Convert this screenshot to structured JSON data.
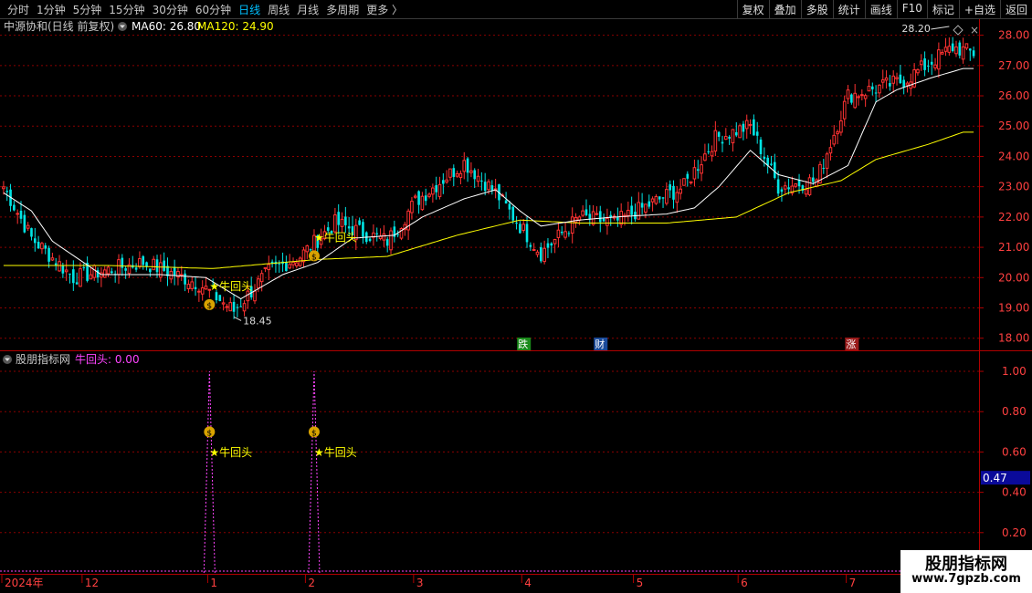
{
  "toolbar": {
    "periods": [
      "分时",
      "1分钟",
      "5分钟",
      "15分钟",
      "30分钟",
      "60分钟",
      "日线",
      "周线",
      "月线",
      "多周期",
      "更多 〉"
    ],
    "active_period": "日线",
    "tools": [
      "复权",
      "叠加",
      "多股",
      "统计",
      "画线",
      "F10",
      "标记",
      "+自选",
      "返回"
    ]
  },
  "main_header": {
    "title": "中源协和(日线 前复权)",
    "ma60": "MA60: 26.80",
    "ma120": "MA120: 24.90",
    "ma60_color": "#ffffff",
    "ma120_color": "#ffff00"
  },
  "indicator_header": {
    "title": "股朋指标网",
    "value_label": "牛回头: 0.00"
  },
  "markers": {
    "signal_label": "★牛回头",
    "bag_glyph": "$",
    "high_label": "28.20",
    "low_label": "18.45",
    "events": [
      "跌",
      "财",
      "涨"
    ],
    "current_value": "0.47"
  },
  "watermark": {
    "name": "股朋指标网",
    "url": "www.7gpzb.com"
  },
  "colors": {
    "up": "#ff3232",
    "down": "#00e5e5",
    "ma_short": "#ffffff",
    "ma_long": "#ffff00",
    "signal": "#ff44ff",
    "grid": "#8b0000"
  },
  "chart_data": {
    "type": "candlestick",
    "title": "中源协和(日线 前复权)",
    "y_ticks": [
      "28.00",
      "27.00",
      "26.00",
      "25.00",
      "24.00",
      "23.00",
      "22.00",
      "21.00",
      "20.00",
      "19.00",
      "18.00"
    ],
    "ylim": [
      17.6,
      28.5
    ],
    "x_labels": [
      "2024年",
      "12",
      "1",
      "2",
      "3",
      "4",
      "5",
      "6",
      "7"
    ],
    "x_label_positions": [
      0,
      23,
      59,
      87,
      118,
      149,
      181,
      211,
      242
    ],
    "n_bars": 279,
    "ohlc_keypoints": [
      [
        0,
        23.0
      ],
      [
        8,
        21.3
      ],
      [
        20,
        20.0
      ],
      [
        40,
        20.5
      ],
      [
        56,
        19.8
      ],
      [
        66,
        18.9
      ],
      [
        76,
        20.2
      ],
      [
        85,
        20.7
      ],
      [
        95,
        21.8
      ],
      [
        110,
        21.2
      ],
      [
        118,
        22.5
      ],
      [
        132,
        23.8
      ],
      [
        141,
        22.8
      ],
      [
        148,
        21.7
      ],
      [
        154,
        20.8
      ],
      [
        165,
        22.0
      ],
      [
        175,
        21.8
      ],
      [
        195,
        23.0
      ],
      [
        204,
        24.6
      ],
      [
        214,
        25.0
      ],
      [
        222,
        23.0
      ],
      [
        233,
        23.2
      ],
      [
        242,
        26.0
      ],
      [
        258,
        26.5
      ],
      [
        272,
        27.6
      ],
      [
        278,
        27.4
      ]
    ],
    "ma_short_keypoints": [
      [
        0,
        22.8
      ],
      [
        8,
        22.2
      ],
      [
        14,
        21.2
      ],
      [
        28,
        20.1
      ],
      [
        45,
        20.1
      ],
      [
        58,
        20.0
      ],
      [
        68,
        19.3
      ],
      [
        80,
        20.1
      ],
      [
        90,
        20.5
      ],
      [
        100,
        21.3
      ],
      [
        112,
        21.4
      ],
      [
        120,
        22.0
      ],
      [
        132,
        22.6
      ],
      [
        141,
        22.9
      ],
      [
        148,
        22.2
      ],
      [
        154,
        21.7
      ],
      [
        165,
        21.9
      ],
      [
        175,
        22.0
      ],
      [
        190,
        22.1
      ],
      [
        198,
        22.3
      ],
      [
        205,
        23.0
      ],
      [
        214,
        24.2
      ],
      [
        222,
        23.4
      ],
      [
        232,
        23.1
      ],
      [
        242,
        23.7
      ],
      [
        250,
        25.8
      ],
      [
        256,
        26.2
      ],
      [
        266,
        26.6
      ],
      [
        275,
        26.9
      ]
    ],
    "ma_long_keypoints": [
      [
        0,
        20.4
      ],
      [
        30,
        20.4
      ],
      [
        60,
        20.3
      ],
      [
        90,
        20.6
      ],
      [
        110,
        20.7
      ],
      [
        130,
        21.4
      ],
      [
        148,
        21.9
      ],
      [
        165,
        21.8
      ],
      [
        190,
        21.8
      ],
      [
        210,
        22.0
      ],
      [
        225,
        22.8
      ],
      [
        240,
        23.2
      ],
      [
        250,
        23.9
      ],
      [
        265,
        24.4
      ],
      [
        275,
        24.8
      ]
    ],
    "indicator": {
      "name": "牛回头",
      "y_ticks": [
        "1.00",
        "0.80",
        "0.60",
        "0.40",
        "0.20"
      ],
      "ylim": [
        0,
        1.05
      ],
      "signal_bars": [
        59,
        89
      ],
      "signal_value": 1.0
    }
  }
}
